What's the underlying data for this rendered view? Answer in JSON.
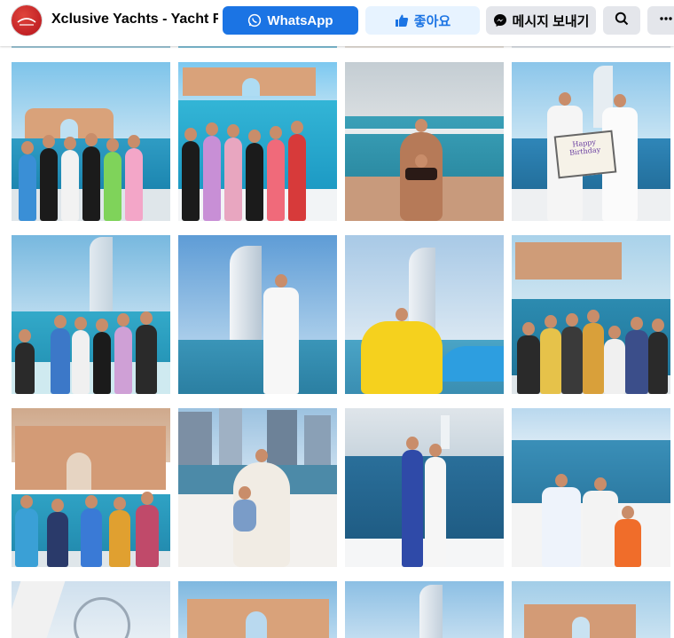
{
  "header": {
    "page_title": "Xclusive Yachts - Yacht R...",
    "logo_icon": "xclusive-yachts-logo",
    "whatsapp_label": "WhatsApp",
    "like_label": "좋아요",
    "message_label": "메시지 보내기",
    "search_icon": "search-icon",
    "more_icon": "more-icon"
  },
  "colors": {
    "primary_blue": "#1b74e4",
    "light_blue": "#e7f3ff",
    "grey_button": "#e4e6eb"
  },
  "photos": [
    {
      "scene": "girls-group-atlantis"
    },
    {
      "scene": "girls-group-bow-atlantis"
    },
    {
      "scene": "woman-bikini-deck"
    },
    {
      "scene": "couple-sign-burj-al-arab",
      "sign_text": "Happy Birthday"
    },
    {
      "scene": "group-burj-al-arab"
    },
    {
      "scene": "man-white-burj-al-arab"
    },
    {
      "scene": "woman-yellow-dress"
    },
    {
      "scene": "group-leis-atlantis"
    },
    {
      "scene": "girls-group-atlantis-2"
    },
    {
      "scene": "woman-baby-marina"
    },
    {
      "scene": "couple-kiss-sea"
    },
    {
      "scene": "family-bow"
    },
    {
      "scene": "ain-dubai-wheel"
    },
    {
      "scene": "atlantis-view"
    },
    {
      "scene": "burj-al-arab-view"
    },
    {
      "scene": "atlantis-view-2"
    }
  ]
}
